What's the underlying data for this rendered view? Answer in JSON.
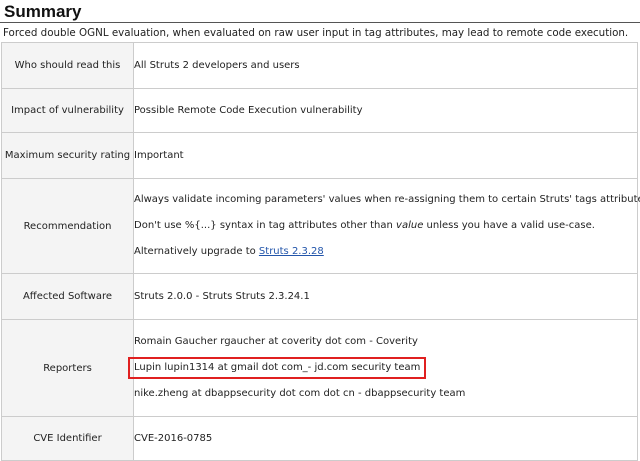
{
  "page": {
    "title": "Summary",
    "intro": "Forced double OGNL evaluation, when evaluated on raw user input in tag attributes, may lead to remote code execution."
  },
  "rows": {
    "who": {
      "label": "Who should read this",
      "value": "All Struts 2 developers and users"
    },
    "impact": {
      "label": "Impact of vulnerability",
      "value": "Possible Remote Code Execution vulnerability"
    },
    "rating": {
      "label": "Maximum security rating",
      "value": "Important"
    },
    "recommendation": {
      "label": "Recommendation",
      "line1": "Always validate incoming parameters' values when re-assigning them to certain Struts' tags attributes.",
      "line2_pre": "Don't use %{...} syntax in tag attributes other than ",
      "line2_em": "value",
      "line2_post": " unless you have a valid use-case.",
      "line3_pre": "Alternatively upgrade to ",
      "line3_link": "Struts 2.3.28"
    },
    "affected": {
      "label": "Affected Software",
      "value": "Struts 2.0.0 - Struts Struts 2.3.24.1"
    },
    "reporters": {
      "label": "Reporters",
      "items": [
        "Romain Gaucher rgaucher at coverity dot com - Coverity",
        "Lupin lupin1314 at gmail dot com_- jd.com security team",
        "nike.zheng at dbappsecurity dot com dot cn - dbappsecurity team"
      ]
    },
    "cve": {
      "label": "CVE Identifier",
      "value": "CVE-2016-0785"
    }
  },
  "colors": {
    "highlight_border": "#e02020",
    "link": "#2255aa",
    "label_bg": "#f4f4f4",
    "cell_border": "#cccccc"
  }
}
